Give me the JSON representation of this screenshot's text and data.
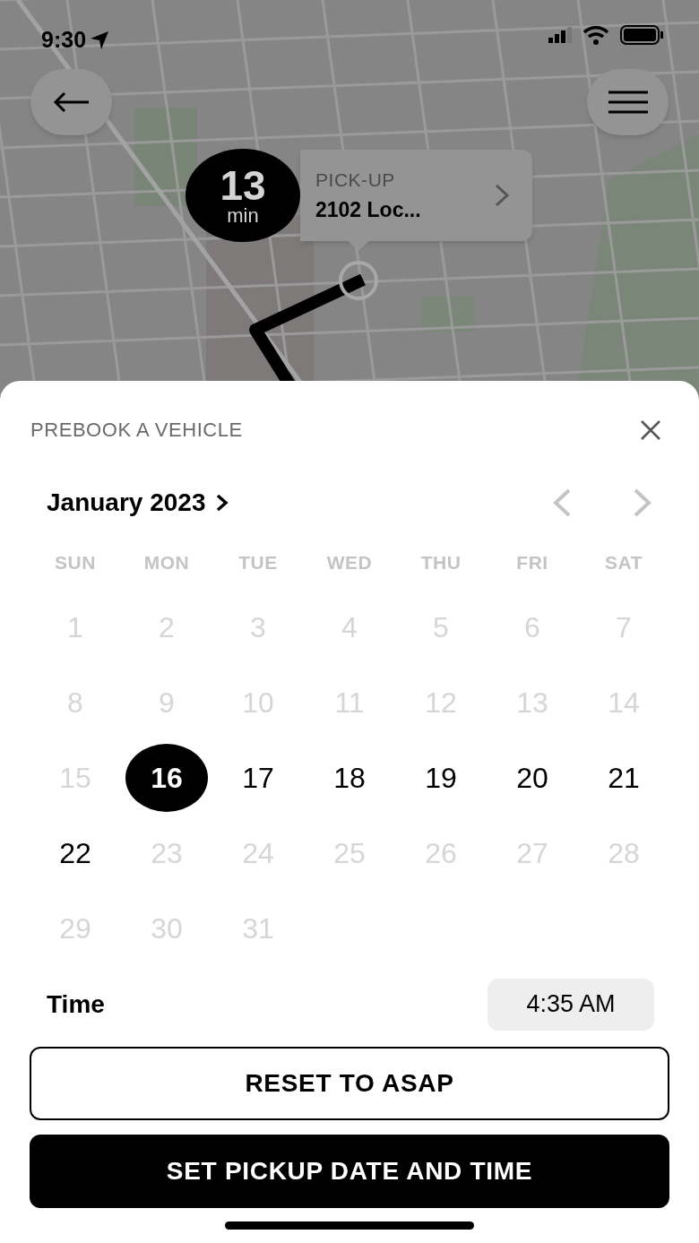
{
  "status_bar": {
    "time": "9:30"
  },
  "map": {
    "eta": {
      "value": "13",
      "unit": "min"
    },
    "pickup": {
      "label": "PICK-UP",
      "address": "2102 Loc..."
    }
  },
  "sheet": {
    "title": "PREBOOK A VEHICLE",
    "month": "January 2023",
    "weekdays": [
      "SUN",
      "MON",
      "TUE",
      "WED",
      "THU",
      "FRI",
      "SAT"
    ],
    "days": [
      {
        "label": "1",
        "disabled": true,
        "selected": false
      },
      {
        "label": "2",
        "disabled": true,
        "selected": false
      },
      {
        "label": "3",
        "disabled": true,
        "selected": false
      },
      {
        "label": "4",
        "disabled": true,
        "selected": false
      },
      {
        "label": "5",
        "disabled": true,
        "selected": false
      },
      {
        "label": "6",
        "disabled": true,
        "selected": false
      },
      {
        "label": "7",
        "disabled": true,
        "selected": false
      },
      {
        "label": "8",
        "disabled": true,
        "selected": false
      },
      {
        "label": "9",
        "disabled": true,
        "selected": false
      },
      {
        "label": "10",
        "disabled": true,
        "selected": false
      },
      {
        "label": "11",
        "disabled": true,
        "selected": false
      },
      {
        "label": "12",
        "disabled": true,
        "selected": false
      },
      {
        "label": "13",
        "disabled": true,
        "selected": false
      },
      {
        "label": "14",
        "disabled": true,
        "selected": false
      },
      {
        "label": "15",
        "disabled": true,
        "selected": false
      },
      {
        "label": "16",
        "disabled": false,
        "selected": true
      },
      {
        "label": "17",
        "disabled": false,
        "selected": false
      },
      {
        "label": "18",
        "disabled": false,
        "selected": false
      },
      {
        "label": "19",
        "disabled": false,
        "selected": false
      },
      {
        "label": "20",
        "disabled": false,
        "selected": false
      },
      {
        "label": "21",
        "disabled": false,
        "selected": false
      },
      {
        "label": "22",
        "disabled": false,
        "selected": false
      },
      {
        "label": "23",
        "disabled": true,
        "selected": false
      },
      {
        "label": "24",
        "disabled": true,
        "selected": false
      },
      {
        "label": "25",
        "disabled": true,
        "selected": false
      },
      {
        "label": "26",
        "disabled": true,
        "selected": false
      },
      {
        "label": "27",
        "disabled": true,
        "selected": false
      },
      {
        "label": "28",
        "disabled": true,
        "selected": false
      },
      {
        "label": "29",
        "disabled": true,
        "selected": false
      },
      {
        "label": "30",
        "disabled": true,
        "selected": false
      },
      {
        "label": "31",
        "disabled": true,
        "selected": false
      }
    ],
    "time_label": "Time",
    "time_value": "4:35 AM",
    "buttons": [
      {
        "label": "RESET TO ASAP",
        "kind": "secondary"
      },
      {
        "label": "SET PICKUP DATE AND TIME",
        "kind": "primary"
      }
    ]
  }
}
